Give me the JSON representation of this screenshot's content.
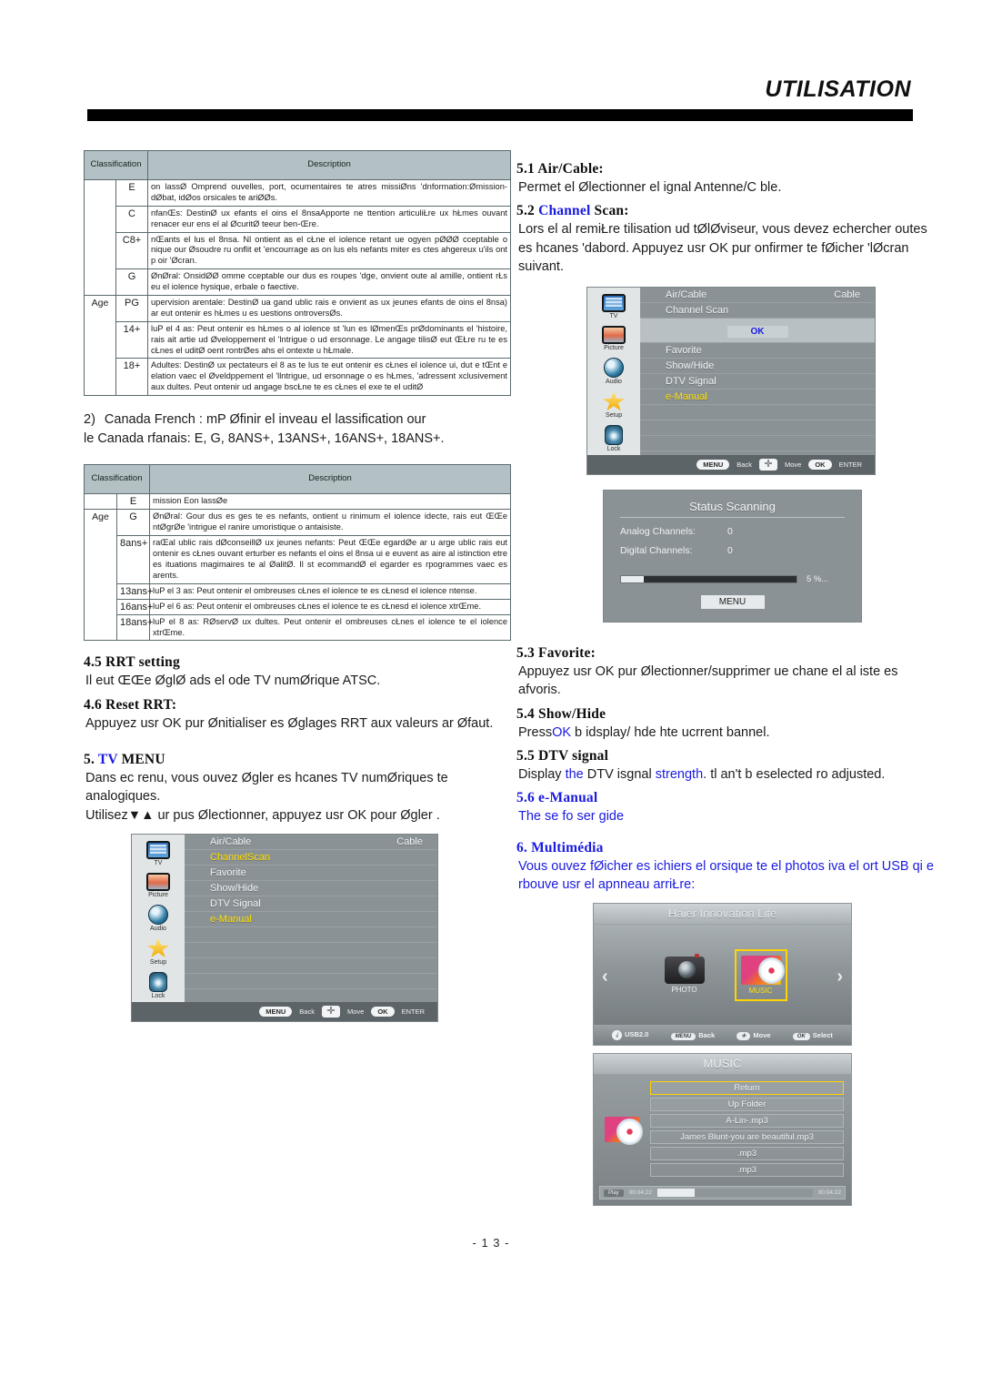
{
  "header": {
    "title": "UTILISATION"
  },
  "page_number": "- 1 3 -",
  "table1": {
    "headers": {
      "classification": "Classification",
      "description": "Description"
    },
    "age_label": "Age",
    "rows": [
      {
        "code": "E",
        "desc": "on lassØ  Omprend ouvelles, port, ocumentaires te atres missiØns 'dnformation:Ømission-dØbat, idØos orsicales te ariØØs."
      },
      {
        "code": "C",
        "desc": "nfanŒs: DestinØ ux efants el oins el 8nsaApporte ne ttention articuliŁre ux hŁmes ouvant renacer eur ens el al ØcuritØ teeur ben-Œre."
      },
      {
        "code": "C8+",
        "desc": "nŒants el lus el 8nsa. Nl ontient as el cŁne el iolence retant ue ogyen pØØØ cceptable o nique our Øsoudre ru onflit et 'encourrage as on lus els nefants  miter es ctes ahgereux u'ils ont p oir 'Øcran."
      },
      {
        "code": "G",
        "desc": "ØnØral: OnsidØØ omme cceptable our dus es roupes 'dge, onvient oute al amille, ontient rŁs eu el iolence hysique, erbale o faective."
      },
      {
        "code": "PG",
        "desc": "upervision arentale: DestinØ ua gand ublic rais e onvient as ux jeunes efants de oins el 8nsa) ar eut ontenir es hŁmes u es uestions ontroversØs."
      },
      {
        "code": "14+",
        "desc": "luP el 4 as: Peut ontenir es hŁmes o al iolence st 'lun es lØmenŒs prØdominants el 'histoire, rais ait artie ud Øveloppement el 'lntrigue o ud ersonnage. Le angage tilisØ eut ŒŁre ru te es cŁnes el uditØ oent rontrØes ahs el ontexte u hŁmale."
      },
      {
        "code": "18+",
        "desc": "Adultes: DestinØ ux pectateurs el 8 as te lus te eut ontenir es cŁnes el iolence ui, dut e tŒnt e elation vaec el Øveldppement el 'llntrigue, ud ersonnage o es hŁmes, 'adressent xclusivement aux dultes. Peut ontenir ud angage bscŁne te es cŁnes el exe te el uditØ"
      }
    ]
  },
  "mid_note": {
    "number": "2)",
    "line1": "Canada French : mP Øfinir el inveau el lassification our",
    "line2": "le Canada rfanais: E, G, 8ANS+, 13ANS+, 16ANS+, 18ANS+."
  },
  "table2": {
    "headers": {
      "classification": "Classification",
      "description": "Description"
    },
    "age_label": "Age",
    "rows": [
      {
        "code": "E",
        "desc": "mission Eon lassØe"
      },
      {
        "code": "G",
        "desc": "ØnØral: Gour dus es ges te es nefants, ontient u rinimum el iolence idecte, rais eut ŒŒe ntØgrØe 'intrigue el ranire umoristique o antaisiste."
      },
      {
        "code": "8ans+",
        "desc": "raŒal ublic rais dØconseillØ ux jeunes nefants: Peut ŒŒe egardØe ar u arge ublic rais eut ontenir es cŁnes ouvant erturber es nefants el oins el 8nsa ui e euvent as aire al istinction etre es ituations magimaires te al ØalitØ. Il st ecommandØ el egarder es rpogrammes vaec es arents."
      },
      {
        "code": "13ans+",
        "desc": "luP el 3 as: Peut ontenir el ombreuses cŁnes el iolence te es cŁnesd el iolence ntense."
      },
      {
        "code": "16ans+",
        "desc": "luP el 6 as: Peut ontenir el ombreuses cŁnes el iolence te es cŁnesd el iolence xtrŒme."
      },
      {
        "code": "18ans+",
        "desc": "luP el 8 as: RØservØ ux dultes. Peut ontenir el ombreuses cŁnes el iolence te el iolence xtrŒme."
      }
    ]
  },
  "left_sections": {
    "s45": {
      "heading": "4.5 RRT setting",
      "body": "Il eut ŒŒe ØglØ ads el ode TV numØrique ATSC."
    },
    "s46": {
      "heading": "4.6 Reset RRT:",
      "body": "Appuyez usr OK pur Ønitialiser es Øglages RRT aux valeurs ar Øfaut."
    },
    "s5": {
      "num": "5.",
      "heading_blue": "TV",
      "heading_rest": "MENU",
      "body1": "Dans ec renu, vous ouvez Øgler es hcanes TV numØriques te analogiques.",
      "body2": "Utilisez▼▲ ur pus Ølectionner, appuyez usr OK pour Øgler ."
    }
  },
  "right_sections": {
    "s51": {
      "heading": "5.1 Air/Cable:",
      "body": "Permet el Ølectionner el ignal Antenne/C ble."
    },
    "s52": {
      "num": "5.2 ",
      "heading_blue": "Channel",
      "heading_rest": " Scan:",
      "body": "Lors el al remiŁre tilisation ud tØlØviseur, vous devez echercher outes es hcanes 'dabord. Appuyez usr OK pur onfirmer te fØicher 'lØcran suivant."
    },
    "s53": {
      "heading": "5.3 Favorite:",
      "body": "Appuyez usr OK pur Ølectionner/supprimer ue chane el al iste es afvoris."
    },
    "s54": {
      "heading": "5.4 Show/Hide",
      "body_pre": "Press",
      "body_blue": "OK",
      "body_post": " b idsplay/ hde hte ucrrent bannel."
    },
    "s55": {
      "heading": "5.5 DTV signal",
      "p1": "Display ",
      "p1_blue": "the",
      "p2": " DTV isgnal ",
      "p2_blue": "strength",
      "p3": ". tl an't b eselected ro adjusted."
    },
    "s56": {
      "heading": "5.6 e-Manual",
      "body": "The se fo ser gide"
    },
    "s6": {
      "heading": "6. Multimédia",
      "body": "Vous ouvez fØicher es ichiers el orsique te el photos iva el ort USB qi e rbouve usr el apnneau arriŁre:"
    }
  },
  "osd_menus": {
    "top": {
      "side_items": [
        {
          "name": "TV",
          "icon": "tv-icon"
        },
        {
          "name": "Picture",
          "icon": "picture-icon"
        },
        {
          "name": "Audio",
          "icon": "audio-icon"
        },
        {
          "name": "Setup",
          "icon": "star-icon"
        },
        {
          "name": "Lock",
          "icon": "lock-icon"
        }
      ],
      "rows": [
        {
          "label": "Air/Cable",
          "value": "Cable",
          "selected": false
        },
        {
          "label": "Channel Scan",
          "value": "",
          "selected": false
        }
      ],
      "ok_label": "OK",
      "rows2": [
        {
          "label": "Favorite",
          "selected": false
        },
        {
          "label": "Show/Hide",
          "selected": false
        },
        {
          "label": "DTV  Signal",
          "selected": false
        },
        {
          "label": "e-Manual",
          "selected": true
        }
      ],
      "footer": {
        "menu": "MENU",
        "back": "Back",
        "move": "Move",
        "ok": "OK",
        "enter": "ENTER"
      }
    },
    "bottom": {
      "side_items": [
        {
          "name": "TV",
          "icon": "tv-icon"
        },
        {
          "name": "Picture",
          "icon": "picture-icon"
        },
        {
          "name": "Audio",
          "icon": "audio-icon"
        },
        {
          "name": "Setup",
          "icon": "star-icon"
        },
        {
          "name": "Lock",
          "icon": "lock-icon"
        }
      ],
      "rows": [
        {
          "label": "Air/Cable",
          "value": "Cable",
          "selected": false
        },
        {
          "label": "ChannelScan",
          "value": "",
          "selected": true
        },
        {
          "label": "Favorite",
          "value": "",
          "selected": false
        },
        {
          "label": "Show/Hide",
          "value": "",
          "selected": false
        },
        {
          "label": "DTV   Signal",
          "value": "",
          "selected": false
        },
        {
          "label": "e-Manual",
          "value": "",
          "selected": true
        }
      ],
      "footer": {
        "menu": "MENU",
        "back": "Back",
        "move": "Move",
        "ok": "OK",
        "enter": "ENTER"
      }
    }
  },
  "status_panel": {
    "title": "Status  Scanning",
    "analog_label": "Analog  Channels:",
    "analog_value": "0",
    "digital_label": "Digital  Channels:",
    "digital_value": "0",
    "percent": "5 %...",
    "menu_label": "MENU"
  },
  "media_browser": {
    "title": "Haier Innovation Life",
    "left_arrow": "‹",
    "right_arrow": "›",
    "tiles": [
      {
        "label": "PHOTO",
        "selected": false
      },
      {
        "label": "MUSIC",
        "selected": true
      }
    ],
    "footer": {
      "usb": "USB2.0",
      "back": "Back",
      "move": "Move",
      "select": "Select"
    }
  },
  "music_screen": {
    "title": "MUSIC",
    "items": [
      {
        "label": "Return",
        "selected": true
      },
      {
        "label": "Up Folder",
        "selected": false
      },
      {
        "label": "A-Lin-.mp3",
        "selected": false
      },
      {
        "label": "James Blunt-you are beautiful.mp3",
        "selected": false
      },
      {
        "label": ".mp3",
        "selected": false
      },
      {
        "label": ".mp3",
        "selected": false
      }
    ],
    "play_label": "Play",
    "time_elapsed": "00:04:22",
    "time_total": "00:04:22"
  },
  "colors": {
    "accent_blue": "#1a1ae0",
    "osd_highlight": "#ffe100",
    "osd_bg": "#8b9296"
  }
}
